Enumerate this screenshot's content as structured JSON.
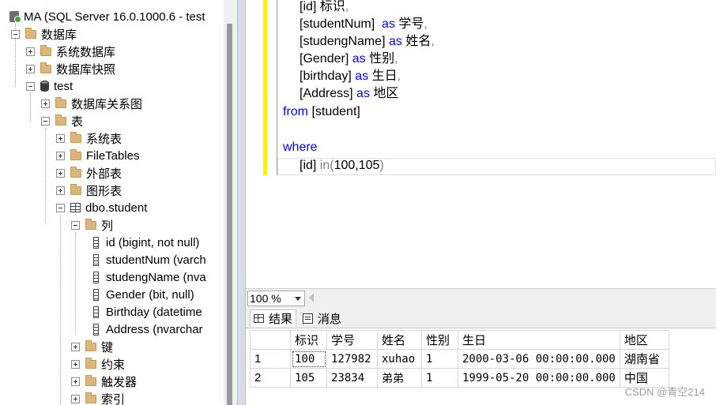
{
  "explorer": {
    "server": "MA (SQL Server 16.0.1000.6 - test",
    "nodes": {
      "databases": "数据库",
      "system_databases": "系统数据库",
      "snapshots": "数据库快照",
      "test": "test",
      "diagrams": "数据库关系图",
      "tables": "表",
      "system_tables": "系统表",
      "filetables": "FileTables",
      "external_tables": "外部表",
      "graph_tables": "图形表",
      "student": "dbo.student",
      "columns": "列",
      "keys": "键",
      "constraints": "约束",
      "triggers": "触发器",
      "indexes": "索引"
    },
    "column_items": [
      "id (bigint, not null)",
      "studentNum (varch",
      "studengName (nva",
      "Gender (bit, null)",
      "Birthday (datetime",
      "Address (nvarchar"
    ]
  },
  "editor": {
    "lines": [
      {
        "a": "[id]",
        "b": " 标识",
        "c": ","
      },
      {
        "a": "[studentNum]",
        "kw": "as",
        "b": "学号",
        "c": ","
      },
      {
        "a": "[studengName]",
        "kw": "as",
        "b": "姓名",
        "c": ","
      },
      {
        "a": "[Gender]",
        "kw": "as",
        "b": "性别",
        "c": ","
      },
      {
        "a": "[birthday]",
        "kw": "as",
        "b": "生日",
        "c": ","
      },
      {
        "a": "[Address]",
        "kw": "as",
        "b": "地区",
        "c": ""
      }
    ],
    "from_kw": "from",
    "from_table": "[student]",
    "where_kw": "where",
    "cond_col": "[id]",
    "cond_in": "in",
    "cond_values": "100,105",
    "open_paren": "(",
    "close_paren": ")"
  },
  "zoom": "100 %",
  "results_tabs": {
    "results": "结果",
    "messages": "消息"
  },
  "grid": {
    "columns": [
      "标识",
      "学号",
      "姓名",
      "性别",
      "生日",
      "地区"
    ],
    "rows": [
      {
        "n": "1",
        "id": "100",
        "num": "127982",
        "name": "xuhao",
        "gender": "1",
        "birthday": "2000-03-06 00:00:00.000",
        "region": "湖南省"
      },
      {
        "n": "2",
        "id": "105",
        "num": "23834",
        "name": "弟弟",
        "gender": "1",
        "birthday": "1999-05-20 00:00:00.000",
        "region": "中国"
      }
    ]
  },
  "watermark": "CSDN @青空214"
}
